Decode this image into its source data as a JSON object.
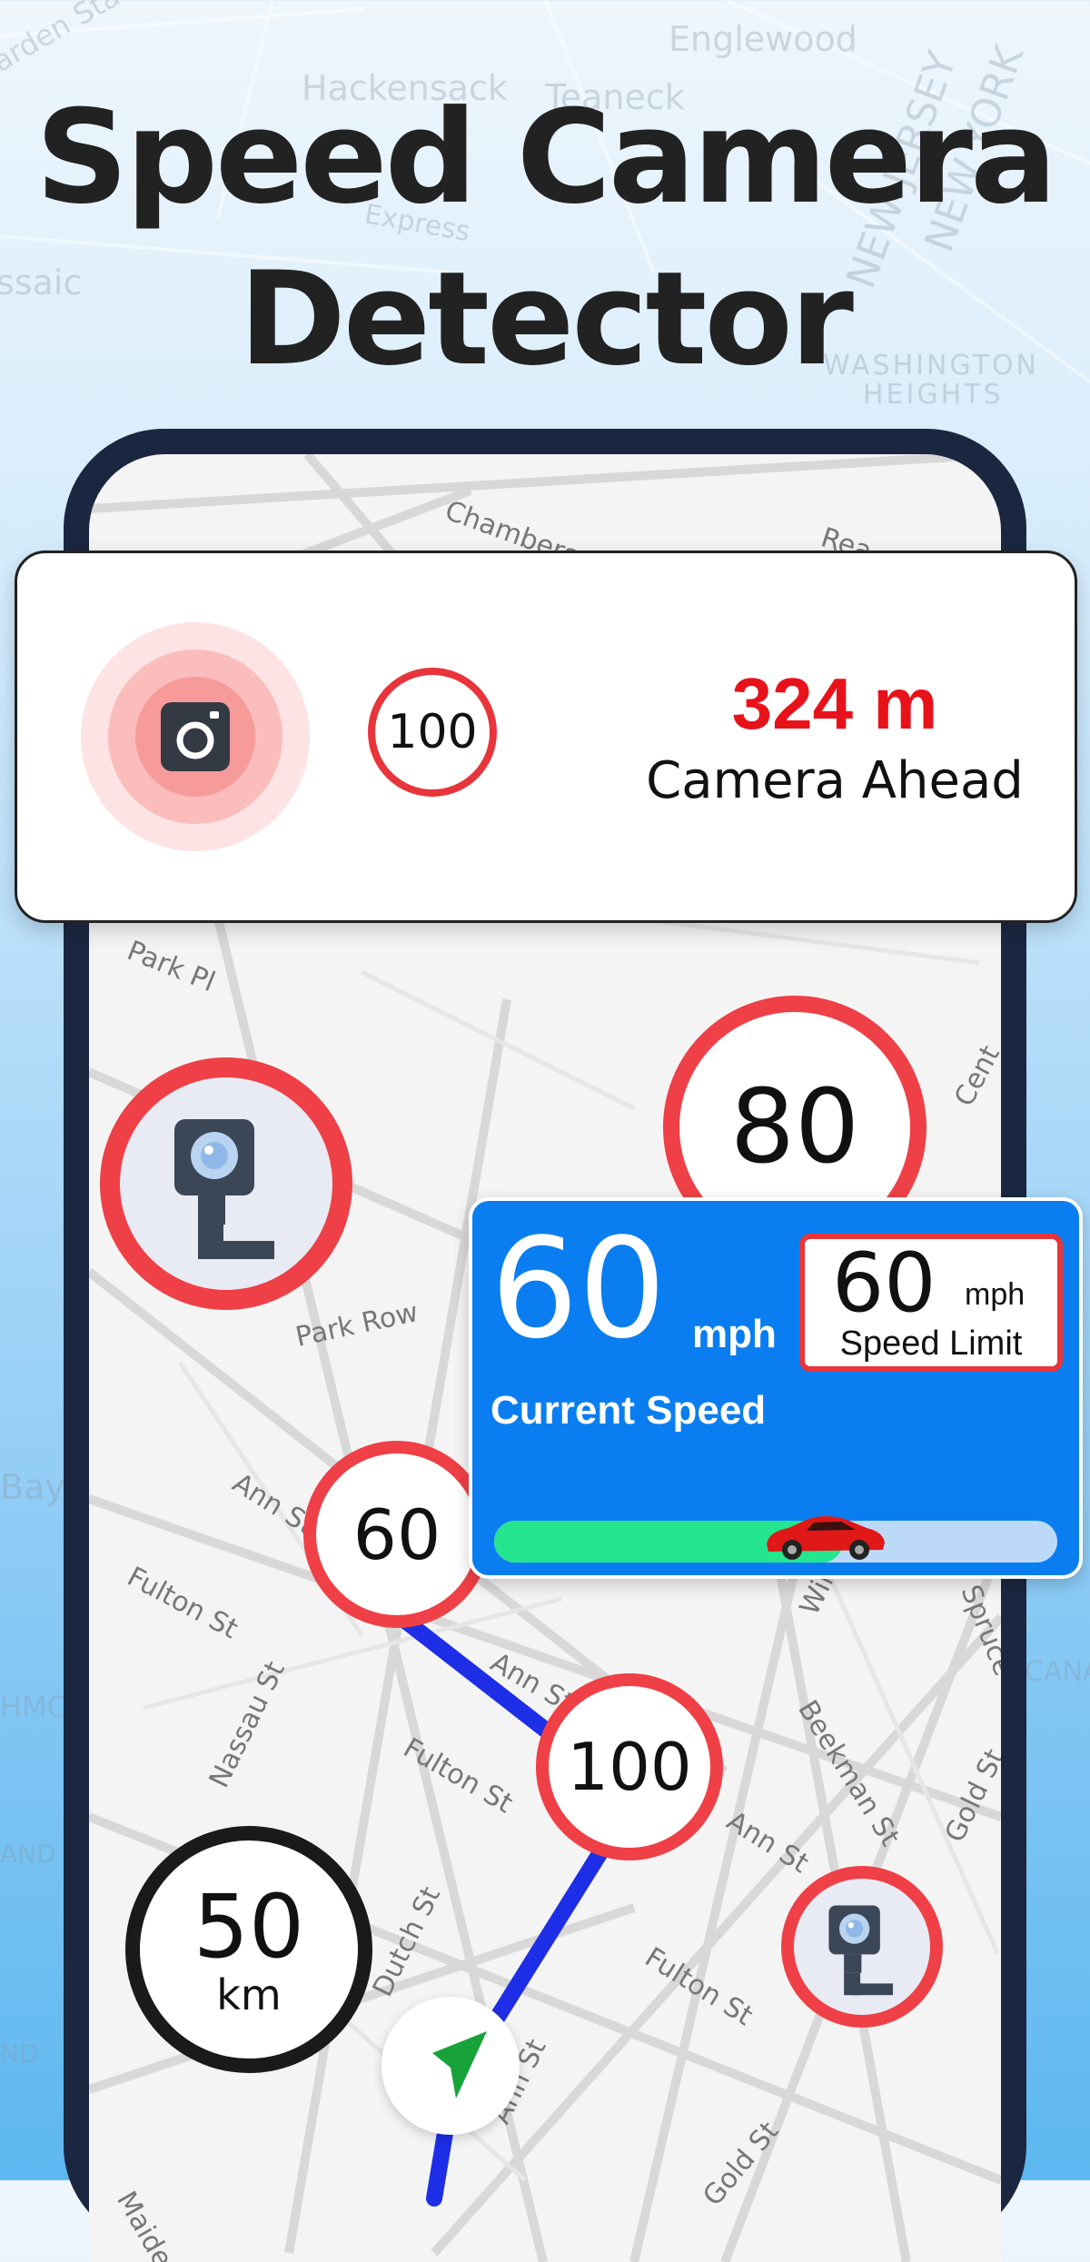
{
  "title": {
    "line1": "Speed Camera",
    "line2": "Detector"
  },
  "background_map_labels": [
    "Englewood",
    "Hackensack",
    "Teaneck",
    "Express",
    "ssaic",
    "NEW JERSEY",
    "NEW YORK",
    "WASHINGTON",
    "HEIGHTS",
    "arden Sta",
    "Bay",
    "HMO",
    "AND",
    "ND",
    "CANA"
  ],
  "screen_map_labels": [
    "Chambers St",
    "Rea",
    "Park Pl",
    "Park Row",
    "Ann St",
    "Fulton St",
    "Ann St",
    "Fulton St",
    "Beekman St",
    "Fulton St",
    "Ann St",
    "William",
    "Spruce",
    "Gold St",
    "Nassau St",
    "Dutch St",
    "Ann St",
    "Gold St",
    "Maiden",
    "Cent"
  ],
  "alert_card": {
    "camera_icon": "camera-icon",
    "speed_limit": "100",
    "distance": "324 m",
    "message": "Camera Ahead"
  },
  "map_markers": {
    "limit_80": "80",
    "limit_60": "60",
    "limit_100": "100",
    "speed_50": {
      "value": "50",
      "unit": "km"
    }
  },
  "speed_panel": {
    "current_speed": "60",
    "unit": "mph",
    "label": "Current Speed",
    "limit_value": "60",
    "limit_unit": "mph",
    "limit_label": "Speed Limit",
    "progress": 0.62
  },
  "colors": {
    "accent_red": "#ee4046",
    "panel_blue": "#0a7ef0",
    "route_blue": "#1d2ee6",
    "progress_green": "#24e68e",
    "nav_green": "#17a33a"
  },
  "icons": [
    "camera-icon",
    "cctv-camera-icon",
    "navigation-arrow-icon",
    "car-icon"
  ]
}
